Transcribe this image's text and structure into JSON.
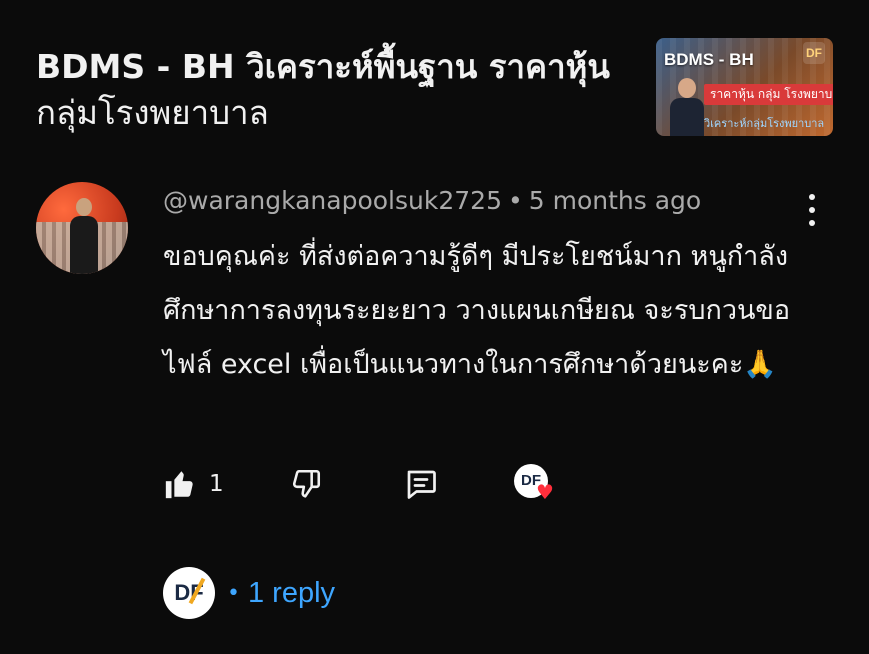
{
  "video": {
    "title_line1": "BDMS - BH วิเคราะห์พื้นฐาน ราคาหุ้น",
    "title_line2": "กลุ่มโรงพยาบาล",
    "thumbnail": {
      "title": "BDMS - BH",
      "logo": "DF",
      "tag": "ราคาหุ้น กลุ่ม โรงพยาบาล",
      "subtitle": "วิเคราะห์กลุ่มโรงพยาบาล"
    }
  },
  "comment": {
    "author": "@warangkanapoolsuk2725",
    "separator": "•",
    "time": "5 months ago",
    "text": "ขอบคุณค่ะ ที่ส่งต่อความรู้ดีๆ มีประโยชน์มาก หนูกำลังศึกษาการลงทุนระยะยาว วางแผนเกษียณ จะรบกวนขอไฟล์ excel เพื่อเป็นแนวทางในการศึกษาด้วยนะคะ🙏",
    "likes": "1",
    "more_icon": "more-vertical-icon"
  },
  "actions": {
    "like_icon": "thumb-up-icon",
    "dislike_icon": "thumb-down-icon",
    "reply_icon": "comment-reply-icon",
    "creator_logo": "DF",
    "heart": "♥"
  },
  "replies": {
    "avatar": "DF",
    "dot": "•",
    "label": "1 reply"
  },
  "colors": {
    "background": "#0b0b0b",
    "text_primary": "#f1f1f1",
    "text_secondary": "#aaaaaa",
    "link": "#3ea6ff",
    "heart": "#ff2e3b"
  }
}
